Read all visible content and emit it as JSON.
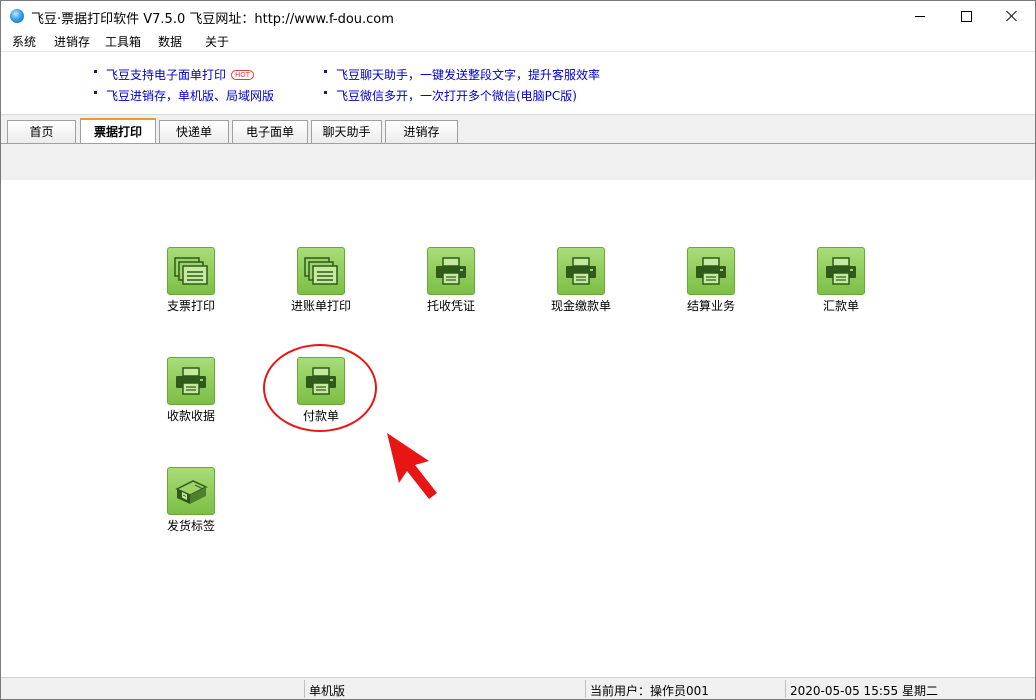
{
  "window": {
    "title": "飞豆·票据打印软件 V7.5.0  飞豆网址：http://www.f-dou.com"
  },
  "menu": [
    "系统",
    "进销存",
    "工具箱",
    "数据",
    "关于"
  ],
  "ads": {
    "left": [
      "飞豆支持电子面单打印",
      "飞豆进销存，单机版、局域网版"
    ],
    "right": [
      "飞豆聊天助手，一键发送整段文字，提升客服效率",
      "飞豆微信多开，一次打开多个微信(电脑PC版)"
    ],
    "hot_badge": "HOT"
  },
  "tabs": [
    {
      "label": "首页",
      "active": false
    },
    {
      "label": "票据打印",
      "active": true
    },
    {
      "label": "快递单",
      "active": false
    },
    {
      "label": "电子面单",
      "active": false
    },
    {
      "label": "聊天助手",
      "active": false
    },
    {
      "label": "进销存",
      "active": false
    }
  ],
  "tiles": [
    {
      "label": "支票打印",
      "icon": "stacked-forms-icon"
    },
    {
      "label": "进账单打印",
      "icon": "stacked-forms-icon"
    },
    {
      "label": "托收凭证",
      "icon": "printer-icon"
    },
    {
      "label": "现金缴款单",
      "icon": "printer-icon"
    },
    {
      "label": "结算业务",
      "icon": "printer-icon"
    },
    {
      "label": "汇款单",
      "icon": "printer-icon"
    },
    {
      "label": "收款收据",
      "icon": "printer-icon"
    },
    {
      "label": "付款单",
      "icon": "printer-icon"
    },
    {
      "label": "发货标签",
      "icon": "label-printer-icon"
    }
  ],
  "status": {
    "edition": "单机版",
    "user": "当前用户：操作员001",
    "datetime": "2020-05-05 15:55 星期二"
  },
  "colors": {
    "tile_green": "#7cbf45",
    "link_blue": "#0000cc",
    "annotation_red": "#e81515"
  }
}
